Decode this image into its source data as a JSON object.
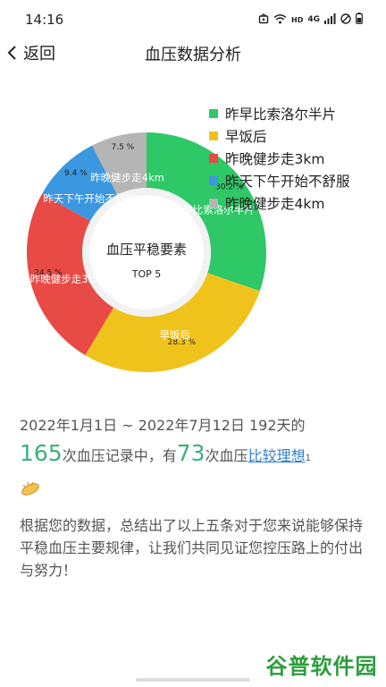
{
  "status": {
    "time": "14:16",
    "icons": [
      "screen-icon",
      "wifi-icon",
      "hd-icon",
      "4g-icon",
      "signal-icon",
      "dnd-icon",
      "battery-icon"
    ],
    "hd_label": "HD",
    "net_label": "4G"
  },
  "nav": {
    "back_label": "返回",
    "title": "血压数据分析"
  },
  "chart": {
    "center_title": "血压平稳要素",
    "center_subtitle": "TOP 5"
  },
  "chart_data": {
    "type": "pie",
    "variant": "donut",
    "legend_position": "top-right",
    "labels": [
      "昨早比索洛尔半片",
      "早饭后",
      "昨晚健步走3km",
      "昨天下午开始不舒服",
      "昨晚健步走4km"
    ],
    "values": [
      30.2,
      28.3,
      24.5,
      9.4,
      7.5
    ],
    "value_labels": [
      "30.2 %",
      "28.3 %",
      "24.5 %",
      "9.4 %",
      "7.5 %"
    ],
    "colors": [
      "#2ec866",
      "#f0c31c",
      "#e84a45",
      "#3b97e0",
      "#b5b5b5"
    ]
  },
  "summary": {
    "date_range": "2022年1月1日 ~ 2022年7月12日 192天的",
    "records_count": "165",
    "records_text": "次血压记录中，有",
    "good_count": "73",
    "good_text": "次血压",
    "link_text": "比较理想",
    "sup": "1"
  },
  "paragraph": "根据您的数据，总结出了以上五条对于您来说能够保持平稳血压主要规律，让我们共同见证您控压路上的付出与努力！",
  "watermark": "谷普软件园"
}
